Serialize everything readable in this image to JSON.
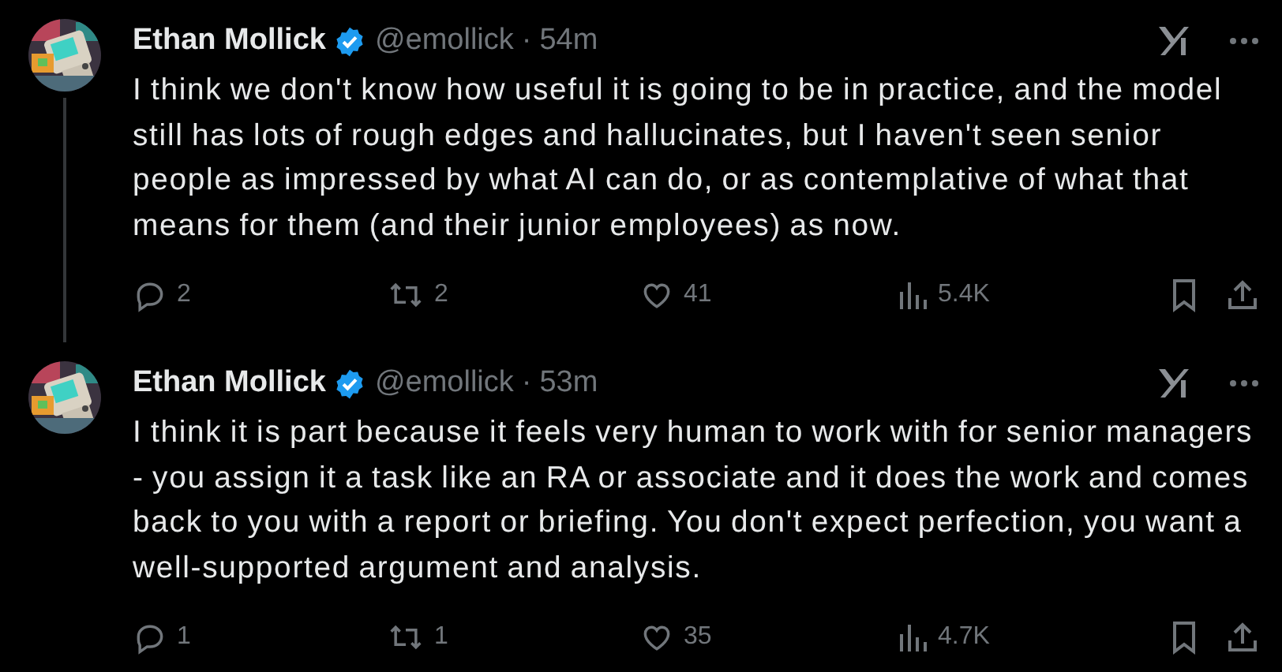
{
  "tweets": [
    {
      "name": "Ethan Mollick",
      "verified": true,
      "handle": "@emollick",
      "separator": "·",
      "time": "54m",
      "thread_line": true,
      "text": "I think we don't know how useful it is going to be in practice, and the model still has lots of rough edges and hallucinates, but I haven't seen senior people as impressed by what AI can do, or as contemplative of what that means for them (and their junior employees) as now.",
      "replies": "2",
      "reposts": "2",
      "likes": "41",
      "views": "5.4K"
    },
    {
      "name": "Ethan Mollick",
      "verified": true,
      "handle": "@emollick",
      "separator": "·",
      "time": "53m",
      "thread_line": false,
      "text": "I think it is part because it feels very human to work with for senior managers - you assign it a task like an RA or associate and it does the work and comes back to you with a report or briefing. You don't expect perfection, you want a well-supported argument and analysis.",
      "replies": "1",
      "reposts": "1",
      "likes": "35",
      "views": "4.7K"
    }
  ]
}
